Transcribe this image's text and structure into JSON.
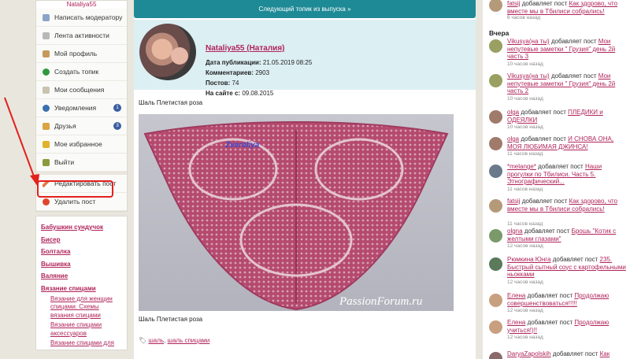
{
  "user": {
    "name": "Nataliya55"
  },
  "menu": [
    {
      "label": "Написать модератору",
      "icon": "mail-icon",
      "color": "#8aa3c9"
    },
    {
      "label": "Лента активности",
      "icon": "feed-icon",
      "color": "#b8b8b8"
    },
    {
      "label": "Мой профиль",
      "icon": "home-icon",
      "color": "#c59a5a"
    },
    {
      "label": "Создать топик",
      "icon": "plus-icon",
      "color": "#2f9a3c"
    },
    {
      "label": "Мои сообщения",
      "icon": "messages-icon",
      "color": "#c9c3b0"
    },
    {
      "label": "Уведомления",
      "icon": "info-icon",
      "color": "#3a6fb0",
      "count": "1"
    },
    {
      "label": "Друзья",
      "icon": "friends-icon",
      "color": "#d9a441",
      "count": "3"
    },
    {
      "label": "Мое избранное",
      "icon": "star-icon",
      "color": "#e0b22b"
    },
    {
      "label": "Выйти",
      "icon": "exit-icon",
      "color": "#8a9a3c"
    }
  ],
  "actions": {
    "edit": "Редактировать пост",
    "delete": "Удалить пост"
  },
  "categories": [
    {
      "label": "Бабушкин сундучок"
    },
    {
      "label": "Бисер"
    },
    {
      "label": "Болталка"
    },
    {
      "label": "Вышивка"
    },
    {
      "label": "Валяние"
    },
    {
      "label": "Вязание спицами"
    }
  ],
  "subcategories": [
    "Вязание для женщин спицами. Схемы вязания спицами",
    "Вязание спицами аксессуаров",
    "Вязание спицами для"
  ],
  "post": {
    "next": "Следующий топик из выпуска »",
    "author": "Nataliya55 (Наталия)",
    "pub_label": "Дата публикации:",
    "pub_value": "21.05.2019 08:25",
    "comments_label": "Комментариев:",
    "comments_value": "2903",
    "posts_label": "Постов:",
    "posts_value": "74",
    "since_label": "На сайте с:",
    "since_value": "09.08.2015",
    "caption_top": "Шаль Плетистая роза",
    "caption_bottom": "Шаль Плетистая роза",
    "watermark_top": "Zveraliya",
    "watermark_bottom": "PassionForum.ru",
    "tags": [
      "шаль",
      "шаль спицами"
    ]
  },
  "feed": {
    "top": {
      "user": "fatsij",
      "action": "добавляет пост",
      "post": "Как здорово, что вместе мы в Тбилиси собрались!",
      "time": "6 часов назад"
    },
    "day": "Вчера",
    "items": [
      {
        "user": "Vikusya(на ты)",
        "action": "добавляет пост",
        "post": "Мои непутевые заметки \" Грузия\" день 2й часть 3",
        "time": "10 часов назад",
        "color": "#9aa062"
      },
      {
        "user": "Vikusya(на ты)",
        "action": "добавляет пост",
        "post": "Мои непутевые заметки \" Грузия\" день 2й часть 2",
        "time": "10 часов назад",
        "color": "#9aa062"
      },
      {
        "user": "olga",
        "action": "добавляет пост",
        "post": "ПЛЕДИКИ и ОДЕЯЛКИ",
        "time": "10 часов назад",
        "color": "#a07a6a"
      },
      {
        "user": "olga",
        "action": "добавляет пост",
        "post": "И СНОВА ОНА, МОЯ ЛЮБИМАЯ ДЖИНСА!",
        "time": "11 часов назад",
        "color": "#a07a6a"
      },
      {
        "user": "*melange*",
        "action": "добавляет пост",
        "post": "Наши прогулки по Тбилиси. Часть 5. Этнографический...",
        "time": "11 часов назад",
        "color": "#6a7a8a"
      },
      {
        "user": "fatsij",
        "action": "добавляет пост",
        "post": "Как здорово, что вместе мы в Тбилиси собрались!",
        "time": "11 часов назад",
        "color": "#b59a7a"
      },
      {
        "user": "olgna",
        "action": "добавляет пост",
        "post": "Брошь \"Котик с желтыми глазами\"",
        "time": "12 часов назад",
        "color": "#7a9a6a"
      },
      {
        "user": "Рюмкина Юнга",
        "action": "добавляет пост",
        "post": "235. Быстрый сытный соус с картофельными ньокками",
        "time": "12 часов назад",
        "color": "#5a7a5a"
      },
      {
        "user": "Елена",
        "action": "добавляет пост",
        "post": "Продолжаю совершенствоваться!!!!!",
        "time": "12 часов назад",
        "color": "#c8a080"
      },
      {
        "user": "Елена",
        "action": "добавляет пост",
        "post": "Продолжаю учиться!)!!",
        "time": "12 часов назад",
        "color": "#c8a080"
      },
      {
        "user": "DaryaZapolskih",
        "action": "добавляет пост",
        "post": "Как здорово,",
        "time": "",
        "color": "#8a6a6a"
      }
    ]
  }
}
